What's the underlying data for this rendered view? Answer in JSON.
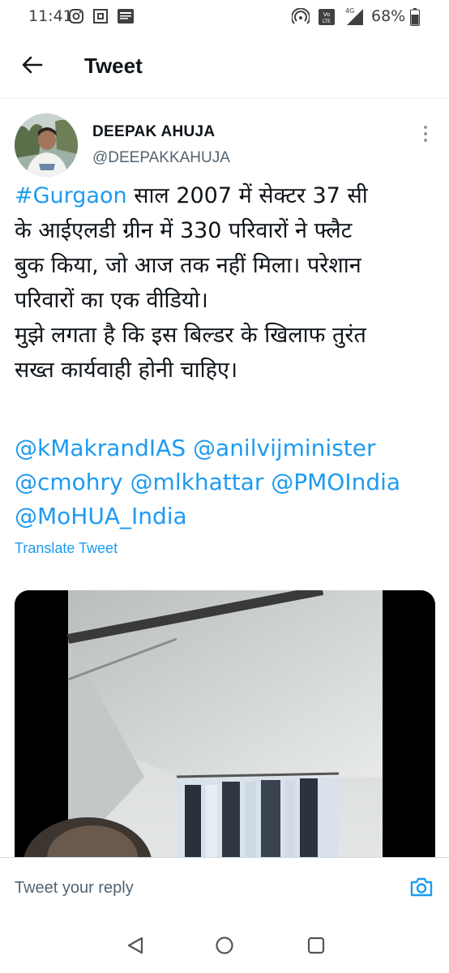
{
  "status_bar": {
    "time": "11:41",
    "battery": "68%",
    "network": "4G",
    "volte": "Vo LTE",
    "icons": [
      "instagram-icon",
      "scan-icon",
      "news-icon",
      "hotspot-icon",
      "volte-icon",
      "signal-icon",
      "battery-icon"
    ]
  },
  "header": {
    "title": "Tweet",
    "back_icon": "arrow-left-icon"
  },
  "tweet": {
    "display_name": "DEEPAK AHUJA",
    "handle": "@DEEPAKKAHUJA",
    "hashtag": "#Gurgaon",
    "text_lines": [
      " साल 2007 में सेक्टर 37 सी",
      "के आईएलडी ग्रीन में 330 परिवारों ने फ्लैट",
      "बुक किया, जो आज तक नहीं मिला। परेशान",
      "परिवारों का एक वीडियो।",
      "मुझे लगता है कि इस बिल्डर के खिलाफ तुरंत",
      "सख्त कार्यवाही होनी चाहिए।"
    ],
    "mentions": [
      "@kMakrandIAS",
      "@anilvijminister",
      "@cmohry",
      "@mlkhattar",
      "@PMOIndia",
      "@MoHUA_India"
    ],
    "translate_label": "Translate Tweet"
  },
  "reply": {
    "placeholder": "Tweet your reply",
    "camera_icon": "camera-icon"
  },
  "nav": {
    "icons": [
      "back-triangle-icon",
      "home-circle-icon",
      "recents-square-icon"
    ]
  },
  "colors": {
    "link": "#1d9bf0",
    "text": "#0f1419",
    "secondary": "#536471"
  }
}
